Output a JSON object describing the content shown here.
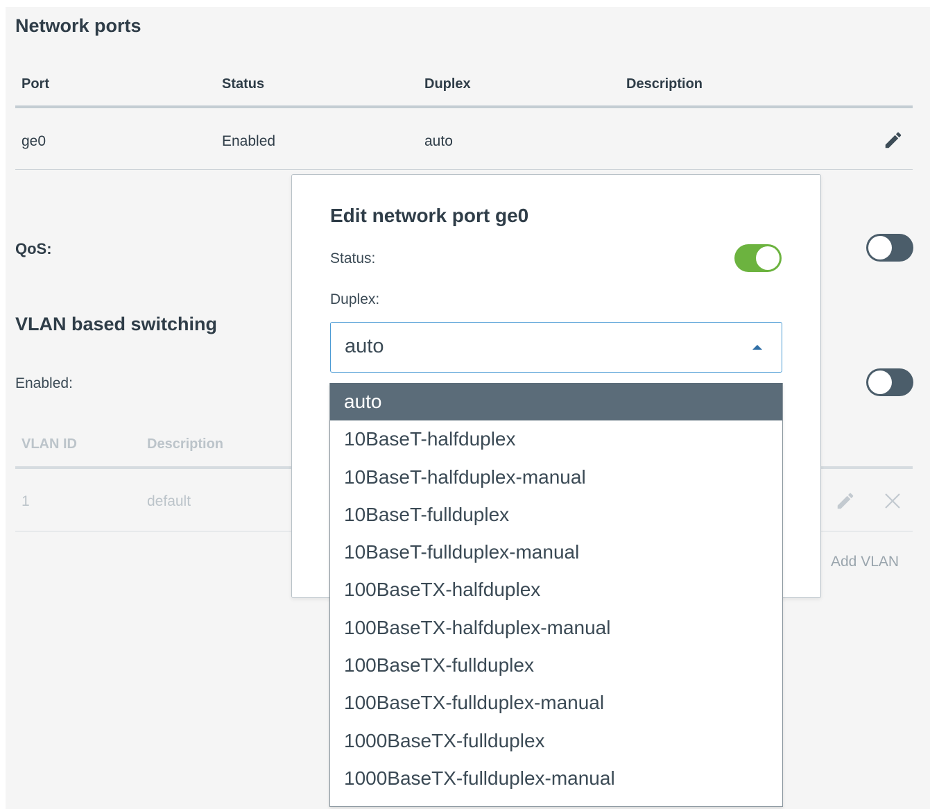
{
  "network_ports": {
    "title": "Network ports",
    "columns": [
      "Port",
      "Status",
      "Duplex",
      "Description"
    ],
    "rows": [
      {
        "port": "ge0",
        "status": "Enabled",
        "duplex": "auto",
        "description": ""
      }
    ]
  },
  "qos": {
    "label": "QoS:",
    "enabled": false
  },
  "vlan": {
    "title": "VLAN based switching",
    "enabled_label": "Enabled:",
    "enabled": false,
    "columns": [
      "VLAN ID",
      "Description"
    ],
    "rows": [
      {
        "id": "1",
        "description": "default"
      }
    ],
    "add_label": "Add VLAN"
  },
  "modal": {
    "title": "Edit network port ge0",
    "status_label": "Status:",
    "status_on": true,
    "duplex_label": "Duplex:",
    "duplex_value": "auto",
    "options": [
      "auto",
      "10BaseT-halfduplex",
      "10BaseT-halfduplex-manual",
      "10BaseT-fullduplex",
      "10BaseT-fullduplex-manual",
      "100BaseTX-halfduplex",
      "100BaseTX-halfduplex-manual",
      "100BaseTX-fullduplex",
      "100BaseTX-fullduplex-manual",
      "1000BaseTX-fullduplex",
      "1000BaseTX-fullduplex-manual"
    ],
    "selected_index": 0
  },
  "colors": {
    "toggle_on": "#6cb33f",
    "toggle_off": "#4b5d6a",
    "selected_option_bg": "#5b6c79",
    "select_border": "#4a9ad4"
  }
}
